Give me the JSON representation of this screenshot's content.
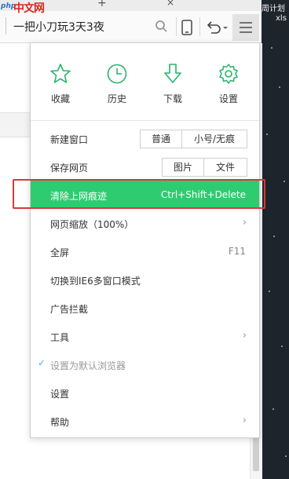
{
  "watermark": {
    "prefix": "php",
    "name": "中文网"
  },
  "tab": {
    "plus": "+"
  },
  "address_bar": {
    "text": "一把小刀玩3天3夜"
  },
  "desktop": {
    "label1": "周计划",
    "label2": "xls"
  },
  "menu": {
    "quick_actions": [
      {
        "label": "收藏",
        "icon": "star-icon"
      },
      {
        "label": "历史",
        "icon": "clock-icon"
      },
      {
        "label": "下载",
        "icon": "download-icon"
      },
      {
        "label": "设置",
        "icon": "gear-icon"
      }
    ],
    "new_window": {
      "label": "新建窗口",
      "options": [
        "普通",
        "小号/无痕"
      ]
    },
    "save_page": {
      "label": "保存网页",
      "options": [
        "图片",
        "文件"
      ]
    },
    "clear_traces": {
      "label": "清除上网痕迹",
      "shortcut": "Ctrl+Shift+Delete"
    },
    "zoom": {
      "label": "网页缩放（100%）"
    },
    "fullscreen": {
      "label": "全屏",
      "shortcut": "F11"
    },
    "ie6_mode": {
      "label": "切换到IE6多窗口模式"
    },
    "ad_block": {
      "label": "广告拦截"
    },
    "tools": {
      "label": "工具"
    },
    "set_default": {
      "label": "设置为默认浏览器",
      "check": "✓"
    },
    "settings": {
      "label": "设置"
    },
    "help": {
      "label": "帮助"
    },
    "chevron": "›"
  },
  "colors": {
    "accent": "#2ecc71",
    "icon": "#27b46a",
    "highlight_border": "#d63a3a"
  }
}
